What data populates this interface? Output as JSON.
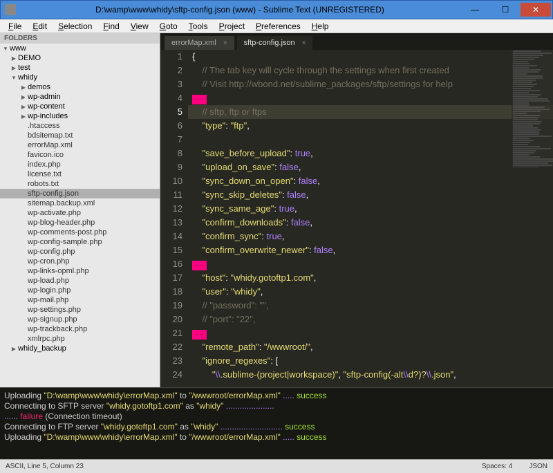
{
  "window": {
    "title": "D:\\wamp\\www\\whidy\\sftp-config.json (www) - Sublime Text (UNREGISTERED)"
  },
  "menu": [
    "File",
    "Edit",
    "Selection",
    "Find",
    "View",
    "Goto",
    "Tools",
    "Project",
    "Preferences",
    "Help"
  ],
  "sidebar": {
    "header": "FOLDERS",
    "items": [
      {
        "type": "folder",
        "open": true,
        "label": "www",
        "indent": 0
      },
      {
        "type": "folder",
        "open": false,
        "label": "DEMO",
        "indent": 1
      },
      {
        "type": "folder",
        "open": false,
        "label": "test",
        "indent": 1
      },
      {
        "type": "folder",
        "open": true,
        "label": "whidy",
        "indent": 1
      },
      {
        "type": "folder",
        "open": false,
        "label": "demos",
        "indent": 2
      },
      {
        "type": "folder",
        "open": false,
        "label": "wp-admin",
        "indent": 2
      },
      {
        "type": "folder",
        "open": false,
        "label": "wp-content",
        "indent": 2
      },
      {
        "type": "folder",
        "open": false,
        "label": "wp-includes",
        "indent": 2
      },
      {
        "type": "file",
        "label": ".htaccess",
        "indent": 2
      },
      {
        "type": "file",
        "label": "bdsitemap.txt",
        "indent": 2
      },
      {
        "type": "file",
        "label": "errorMap.xml",
        "indent": 2
      },
      {
        "type": "file",
        "label": "favicon.ico",
        "indent": 2
      },
      {
        "type": "file",
        "label": "index.php",
        "indent": 2
      },
      {
        "type": "file",
        "label": "license.txt",
        "indent": 2
      },
      {
        "type": "file",
        "label": "robots.txt",
        "indent": 2
      },
      {
        "type": "file",
        "label": "sftp-config.json",
        "indent": 2,
        "selected": true
      },
      {
        "type": "file",
        "label": "sitemap.backup.xml",
        "indent": 2
      },
      {
        "type": "file",
        "label": "wp-activate.php",
        "indent": 2
      },
      {
        "type": "file",
        "label": "wp-blog-header.php",
        "indent": 2
      },
      {
        "type": "file",
        "label": "wp-comments-post.php",
        "indent": 2
      },
      {
        "type": "file",
        "label": "wp-config-sample.php",
        "indent": 2
      },
      {
        "type": "file",
        "label": "wp-config.php",
        "indent": 2
      },
      {
        "type": "file",
        "label": "wp-cron.php",
        "indent": 2
      },
      {
        "type": "file",
        "label": "wp-links-opml.php",
        "indent": 2
      },
      {
        "type": "file",
        "label": "wp-load.php",
        "indent": 2
      },
      {
        "type": "file",
        "label": "wp-login.php",
        "indent": 2
      },
      {
        "type": "file",
        "label": "wp-mail.php",
        "indent": 2
      },
      {
        "type": "file",
        "label": "wp-settings.php",
        "indent": 2
      },
      {
        "type": "file",
        "label": "wp-signup.php",
        "indent": 2
      },
      {
        "type": "file",
        "label": "wp-trackback.php",
        "indent": 2
      },
      {
        "type": "file",
        "label": "xmlrpc.php",
        "indent": 2
      },
      {
        "type": "folder",
        "open": false,
        "label": "whidy_backup",
        "indent": 1
      }
    ]
  },
  "tabs": [
    {
      "label": "errorMap.xml",
      "active": false
    },
    {
      "label": "sftp-config.json",
      "active": true
    }
  ],
  "code": {
    "current_line": 5,
    "lines": [
      {
        "n": 1,
        "tokens": [
          {
            "cls": "c-punc",
            "t": "{"
          }
        ]
      },
      {
        "n": 2,
        "tokens": [
          {
            "cls": "",
            "t": "    "
          },
          {
            "cls": "c-comment",
            "t": "// The tab key will cycle through the settings when first created"
          }
        ]
      },
      {
        "n": 3,
        "tokens": [
          {
            "cls": "",
            "t": "    "
          },
          {
            "cls": "c-comment",
            "t": "// Visit http://wbond.net/sublime_packages/sftp/settings for help"
          }
        ]
      },
      {
        "n": 4,
        "fold": true,
        "tokens": []
      },
      {
        "n": 5,
        "tokens": [
          {
            "cls": "",
            "t": "    "
          },
          {
            "cls": "c-comment",
            "t": "// sftp, ftp or ftps"
          }
        ]
      },
      {
        "n": 6,
        "tokens": [
          {
            "cls": "",
            "t": "    "
          },
          {
            "cls": "c-key",
            "t": "\"type\""
          },
          {
            "cls": "c-punc",
            "t": ": "
          },
          {
            "cls": "c-string",
            "t": "\"ftp\""
          },
          {
            "cls": "c-punc",
            "t": ","
          }
        ]
      },
      {
        "n": 7,
        "tokens": []
      },
      {
        "n": 8,
        "tokens": [
          {
            "cls": "",
            "t": "    "
          },
          {
            "cls": "c-key",
            "t": "\"save_before_upload\""
          },
          {
            "cls": "c-punc",
            "t": ": "
          },
          {
            "cls": "c-bool",
            "t": "true"
          },
          {
            "cls": "c-punc",
            "t": ","
          }
        ]
      },
      {
        "n": 9,
        "tokens": [
          {
            "cls": "",
            "t": "    "
          },
          {
            "cls": "c-key",
            "t": "\"upload_on_save\""
          },
          {
            "cls": "c-punc",
            "t": ": "
          },
          {
            "cls": "c-bool",
            "t": "false"
          },
          {
            "cls": "c-punc",
            "t": ","
          }
        ]
      },
      {
        "n": 10,
        "tokens": [
          {
            "cls": "",
            "t": "    "
          },
          {
            "cls": "c-key",
            "t": "\"sync_down_on_open\""
          },
          {
            "cls": "c-punc",
            "t": ": "
          },
          {
            "cls": "c-bool",
            "t": "false"
          },
          {
            "cls": "c-punc",
            "t": ","
          }
        ]
      },
      {
        "n": 11,
        "tokens": [
          {
            "cls": "",
            "t": "    "
          },
          {
            "cls": "c-key",
            "t": "\"sync_skip_deletes\""
          },
          {
            "cls": "c-punc",
            "t": ": "
          },
          {
            "cls": "c-bool",
            "t": "false"
          },
          {
            "cls": "c-punc",
            "t": ","
          }
        ]
      },
      {
        "n": 12,
        "tokens": [
          {
            "cls": "",
            "t": "    "
          },
          {
            "cls": "c-key",
            "t": "\"sync_same_age\""
          },
          {
            "cls": "c-punc",
            "t": ": "
          },
          {
            "cls": "c-bool",
            "t": "true"
          },
          {
            "cls": "c-punc",
            "t": ","
          }
        ]
      },
      {
        "n": 13,
        "tokens": [
          {
            "cls": "",
            "t": "    "
          },
          {
            "cls": "c-key",
            "t": "\"confirm_downloads\""
          },
          {
            "cls": "c-punc",
            "t": ": "
          },
          {
            "cls": "c-bool",
            "t": "false"
          },
          {
            "cls": "c-punc",
            "t": ","
          }
        ]
      },
      {
        "n": 14,
        "tokens": [
          {
            "cls": "",
            "t": "    "
          },
          {
            "cls": "c-key",
            "t": "\"confirm_sync\""
          },
          {
            "cls": "c-punc",
            "t": ": "
          },
          {
            "cls": "c-bool",
            "t": "true"
          },
          {
            "cls": "c-punc",
            "t": ","
          }
        ]
      },
      {
        "n": 15,
        "tokens": [
          {
            "cls": "",
            "t": "    "
          },
          {
            "cls": "c-key",
            "t": "\"confirm_overwrite_newer\""
          },
          {
            "cls": "c-punc",
            "t": ": "
          },
          {
            "cls": "c-bool",
            "t": "false"
          },
          {
            "cls": "c-punc",
            "t": ","
          }
        ]
      },
      {
        "n": 16,
        "fold": true,
        "tokens": []
      },
      {
        "n": 17,
        "tokens": [
          {
            "cls": "",
            "t": "    "
          },
          {
            "cls": "c-key",
            "t": "\"host\""
          },
          {
            "cls": "c-punc",
            "t": ": "
          },
          {
            "cls": "c-string",
            "t": "\"whidy.gotoftp1.com\""
          },
          {
            "cls": "c-punc",
            "t": ","
          }
        ]
      },
      {
        "n": 18,
        "tokens": [
          {
            "cls": "",
            "t": "    "
          },
          {
            "cls": "c-key",
            "t": "\"user\""
          },
          {
            "cls": "c-punc",
            "t": ": "
          },
          {
            "cls": "c-string",
            "t": "\"whidy\""
          },
          {
            "cls": "c-punc",
            "t": ","
          }
        ]
      },
      {
        "n": 19,
        "tokens": [
          {
            "cls": "",
            "t": "    "
          },
          {
            "cls": "c-comment",
            "t": "// \"password\": \"\","
          }
        ]
      },
      {
        "n": 20,
        "tokens": [
          {
            "cls": "",
            "t": "    "
          },
          {
            "cls": "c-comment",
            "t": "// \"port\": \"22\","
          }
        ]
      },
      {
        "n": 21,
        "fold": true,
        "tokens": []
      },
      {
        "n": 22,
        "tokens": [
          {
            "cls": "",
            "t": "    "
          },
          {
            "cls": "c-key",
            "t": "\"remote_path\""
          },
          {
            "cls": "c-punc",
            "t": ": "
          },
          {
            "cls": "c-string",
            "t": "\"/wwwroot/\""
          },
          {
            "cls": "c-punc",
            "t": ","
          }
        ]
      },
      {
        "n": 23,
        "tokens": [
          {
            "cls": "",
            "t": "    "
          },
          {
            "cls": "c-key",
            "t": "\"ignore_regexes\""
          },
          {
            "cls": "c-punc",
            "t": ": ["
          }
        ]
      },
      {
        "n": 24,
        "tokens": [
          {
            "cls": "",
            "t": "        "
          },
          {
            "cls": "c-string",
            "t": "\""
          },
          {
            "cls": "c-escape",
            "t": "\\\\"
          },
          {
            "cls": "c-string",
            "t": ".sublime-(project|workspace)\""
          },
          {
            "cls": "c-punc",
            "t": ", "
          },
          {
            "cls": "c-string",
            "t": "\"sftp-config(-alt"
          },
          {
            "cls": "c-escape",
            "t": "\\\\"
          },
          {
            "cls": "c-string",
            "t": "d?)?"
          },
          {
            "cls": "c-escape",
            "t": "\\\\"
          },
          {
            "cls": "c-string",
            "t": ".json\""
          },
          {
            "cls": "c-punc",
            "t": ","
          }
        ]
      }
    ]
  },
  "console": {
    "line1_pre": "Uploading ",
    "line1_path": "\"D:\\wamp\\www\\whidy\\errorMap.xml\"",
    "line1_mid": " to ",
    "line1_remote": "\"/wwwroot/errorMap.xml\"",
    "line1_dots": " ..... ",
    "line1_status": "success",
    "line2_pre": "Connecting to SFTP server ",
    "line2_host": "\"whidy.gotoftp1.com\"",
    "line2_mid": " as ",
    "line2_user": "\"whidy\"",
    "line2_dots": " .....................",
    "line3_dots": "...... ",
    "line3_status": "failure",
    "line3_post": " (Connection timeout)",
    "line4_pre": "Connecting to FTP server ",
    "line4_host": "\"whidy.gotoftp1.com\"",
    "line4_mid": " as ",
    "line4_user": "\"whidy\"",
    "line4_dots": " ........................... ",
    "line4_status": "success",
    "line5_pre": "Uploading ",
    "line5_path": "\"D:\\wamp\\www\\whidy\\errorMap.xml\"",
    "line5_mid": " to ",
    "line5_remote": "\"/wwwroot/errorMap.xml\"",
    "line5_dots": " ..... ",
    "line5_status": "success"
  },
  "statusbar": {
    "left": "ASCII, Line 5, Column 23",
    "spaces": "Spaces: 4",
    "syntax": "JSON"
  }
}
